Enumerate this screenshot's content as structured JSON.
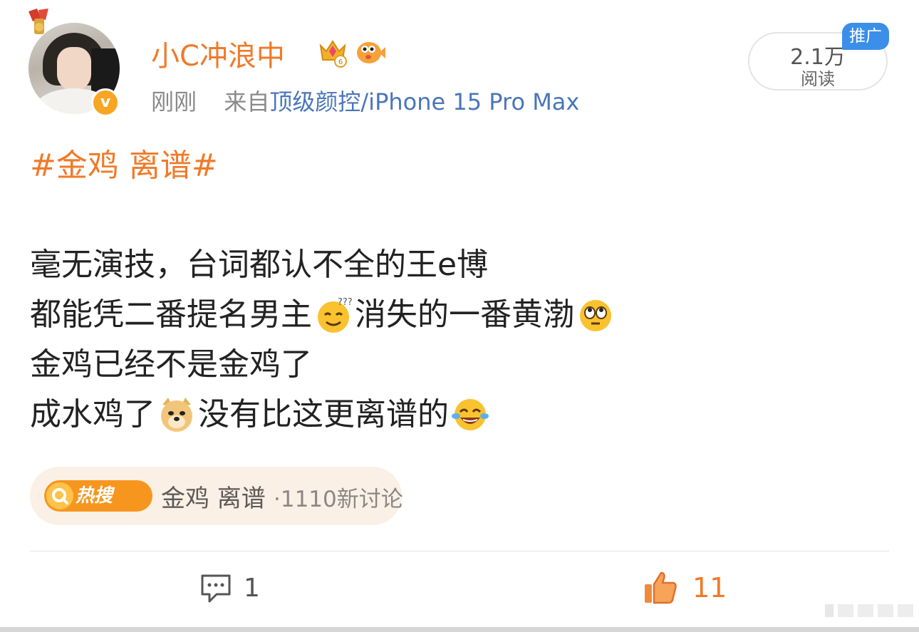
{
  "author": {
    "name": "小C冲浪中",
    "avatar_icon": "avatar-portrait",
    "verified_icon": "verified-v-badge",
    "verified_mark": "v",
    "badges": [
      "crown-level-badge",
      "pufferfish-badge"
    ]
  },
  "meta": {
    "time": "刚刚",
    "source_prefix": "来自",
    "source_link": "顶级颜控",
    "device": "/iPhone 15 Pro Max"
  },
  "stats": {
    "read_count": "2.1万",
    "read_label": "阅读",
    "promo_tag": "推广"
  },
  "post": {
    "hashtag": "#金鸡 离谱#",
    "line1": "毫无演技，台词都认不全的王e博",
    "line2_a": "都能凭二番提名男主",
    "line2_b": "消失的一番黄渤",
    "line3": "金鸡已经不是金鸡了",
    "line4_a": "成水鸡了",
    "line4_b": "没有比这更离谱的",
    "emojis": [
      "confused-emoji",
      "rolling-eyes-emoji",
      "doge-emoji",
      "laughing-tears-emoji"
    ]
  },
  "hot_search": {
    "badge_label": "热搜",
    "topic": "金鸡 离谱",
    "count": "·1110新讨论",
    "colors": {
      "badge": "#f7961e",
      "pill": "#fbf0e6"
    }
  },
  "actions": {
    "comment_count": "1",
    "like_count": "11"
  },
  "colors": {
    "accent_orange": "#f07a2a",
    "link_blue": "#4a76b8",
    "promo_blue": "#3b8fe8"
  }
}
